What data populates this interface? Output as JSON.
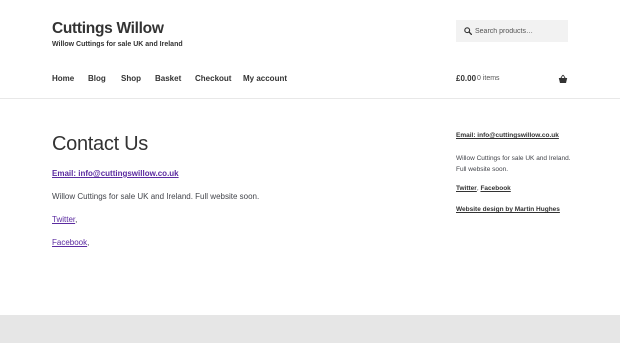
{
  "header": {
    "site_title": "Cuttings Willow",
    "site_description": "Willow Cuttings for sale UK and Ireland"
  },
  "search": {
    "placeholder": "Search products…",
    "icon": "search-icon"
  },
  "nav": {
    "items": [
      {
        "label": "Home"
      },
      {
        "label": "Blog"
      },
      {
        "label": "Shop"
      },
      {
        "label": "Basket"
      },
      {
        "label": "Checkout"
      },
      {
        "label": "My account"
      }
    ]
  },
  "cart": {
    "amount": "£0.00",
    "count": "0 items",
    "icon": "basket-icon"
  },
  "content": {
    "title": "Contact Us",
    "email": "Email: info@cuttingswillow.co.uk",
    "description": "Willow Cuttings for sale UK and Ireland. Full website soon.",
    "twitter": "Twitter",
    "facebook": "Facebook",
    "separator": ","
  },
  "sidebar": {
    "email": "Email: info@cuttingswillow.co.uk",
    "description": "Willow Cuttings for sale UK and Ireland. Full website soon.",
    "twitter": "Twitter",
    "facebook": "Facebook",
    "separator": ",",
    "credit": "Website design by Martin Hughes"
  },
  "colors": {
    "link": "#5b2ba0",
    "text": "#333333",
    "footer_bg": "#e6e6e6",
    "search_bg": "#f2f2f2"
  }
}
